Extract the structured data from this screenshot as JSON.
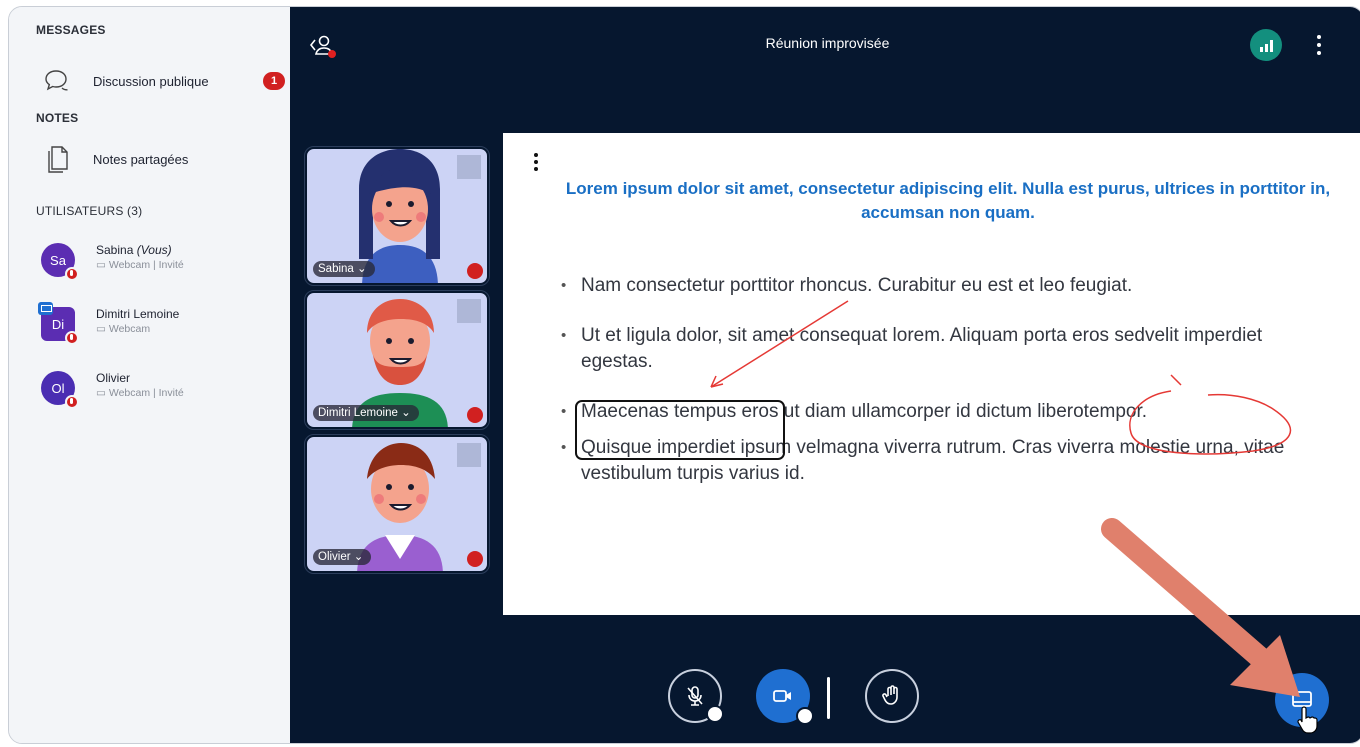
{
  "sidebar": {
    "messages_title": "MESSAGES",
    "public_chat_label": "Discussion publique",
    "public_chat_badge": "1",
    "notes_title": "NOTES",
    "shared_notes_label": "Notes partagées",
    "users_title": "UTILISATEURS (3)",
    "users": [
      {
        "initials": "Sa",
        "name": "Sabina",
        "you": "(Vous)",
        "status": "Webcam | Invité",
        "color": "#5b2db2"
      },
      {
        "initials": "Di",
        "name": "Dimitri Lemoine",
        "you": "",
        "status": "Webcam",
        "color": "#5b2db2"
      },
      {
        "initials": "Ol",
        "name": "Olivier",
        "you": "",
        "status": "Webcam | Invité",
        "color": "#4a2db2"
      }
    ]
  },
  "meeting": {
    "title": "Réunion improvisée"
  },
  "videos": [
    {
      "name": "Sabina"
    },
    {
      "name": "Dimitri Lemoine"
    },
    {
      "name": "Olivier"
    }
  ],
  "slide": {
    "title": "Lorem ipsum dolor sit amet, consectetur adipiscing elit. Nulla est purus, ultrices in porttitor in, accumsan non quam.",
    "bullets": [
      "Nam consectetur porttitor rhoncus. Curabitur eu est et leo feugiat.",
      "Ut et ligula dolor, sit amet consequat lorem. Aliquam porta eros sedvelit imperdiet egestas.",
      "Maecenas tempus eros ut diam ullamcorper id dictum liberotempor.",
      "Quisque imperdiet ipsum velmagna viverra rutrum. Cras viverra molestie urna, vitae vestibulum turpis varius id."
    ]
  },
  "colors": {
    "main_bg": "#06172f",
    "accent_blue": "#1f6fd1",
    "slide_title": "#1a6fc4",
    "alert_red": "#d12020",
    "connection_green": "#138f7e",
    "annotation_arrow": "#e0806c"
  },
  "icons": [
    "chat-icon",
    "notes-icon",
    "users-toggle-icon",
    "connection-icon",
    "more-icon",
    "mic-muted-icon",
    "webcam-icon",
    "raise-hand-icon",
    "presentation-icon",
    "expand-icon"
  ]
}
